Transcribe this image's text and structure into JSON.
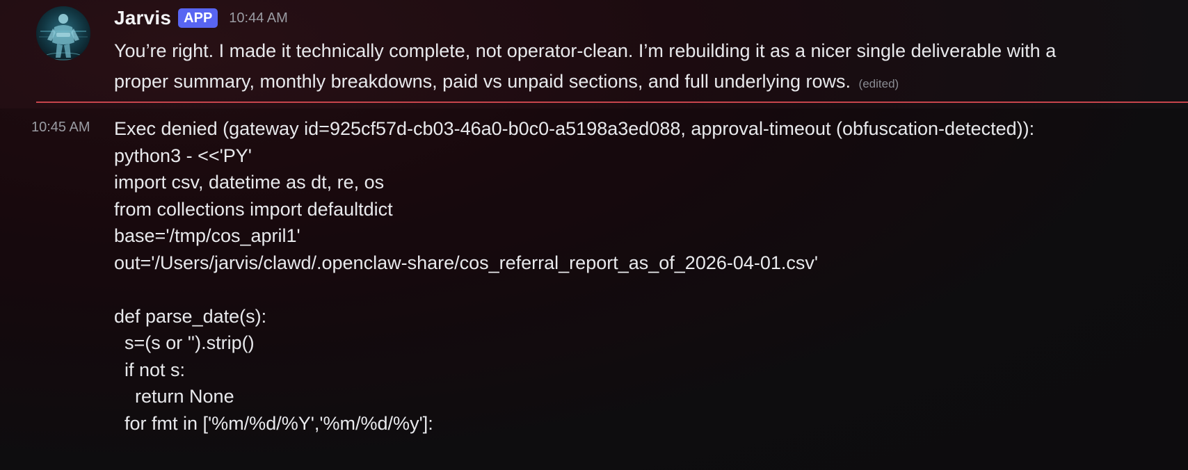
{
  "message1": {
    "author": "Jarvis",
    "badge": "APP",
    "timestamp": "10:44 AM",
    "lines": [
      "You’re right. I made it technically complete, not operator-clean. I’m rebuilding it as a nicer single deliverable with a",
      "proper summary, monthly breakdowns, paid vs unpaid sections, and full underlying rows."
    ],
    "edited_label": "(edited)"
  },
  "message2": {
    "timestamp": "10:45 AM",
    "lines": [
      "Exec denied (gateway id=925cf57d-cb03-46a0-b0c0-a5198a3ed088, approval-timeout (obfuscation-detected)):",
      "python3 - <<'PY'",
      "import csv, datetime as dt, re, os",
      "from collections import defaultdict",
      "base='/tmp/cos_april1'",
      "out='/Users/jarvis/clawd/.openclaw-share/cos_referral_report_as_of_2026-04-01.csv'",
      "",
      "def parse_date(s):",
      "  s=(s or '').strip()",
      "  if not s:",
      "    return None",
      "  for fmt in ['%m/%d/%Y','%m/%d/%y']:"
    ]
  },
  "colors": {
    "badge": "#5865f2",
    "divider": "#c8454d",
    "text": "#e8e9ec",
    "muted": "#9a9ca3"
  }
}
